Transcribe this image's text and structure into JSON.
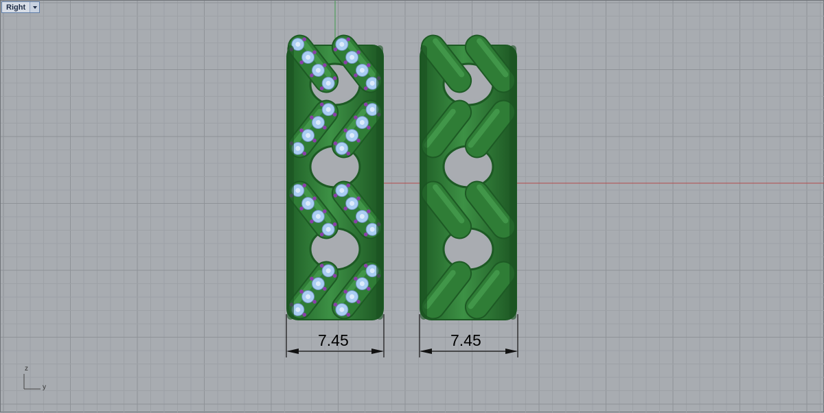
{
  "viewport": {
    "title": "Right",
    "menu_icon": "chevron-down-icon"
  },
  "dimensions": [
    {
      "value": "7.45"
    },
    {
      "value": "7.45"
    }
  ],
  "axes": {
    "vertical": "z",
    "horizontal": "y"
  },
  "colors": {
    "background": "#a8acb1",
    "grid_minor": "#9da1a6",
    "grid_major": "#8e9297",
    "x_axis": "#b54a4a",
    "y_axis": "#3e9a4a",
    "metal": "#2f7d36",
    "metal_dark": "#1d5a24",
    "gem": "#a9cdf2",
    "prong": "#8a3fa8"
  }
}
